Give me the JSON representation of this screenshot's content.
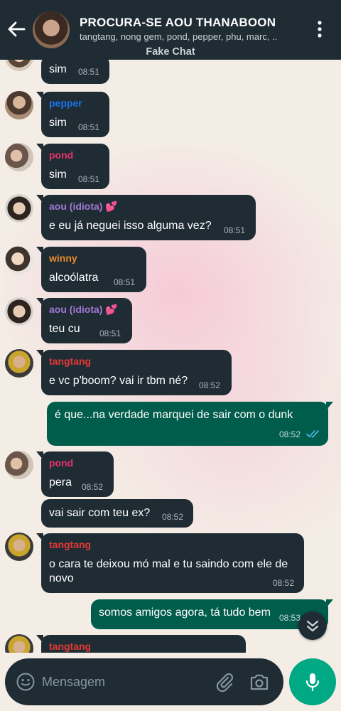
{
  "header": {
    "title": "PROCURA-SE AOU THANABOON",
    "subtitle": "tangtang, nong gem, pond, pepper, phu, marc, ..",
    "watermark": "Fake Chat"
  },
  "messages": [
    {
      "sender": "",
      "text": "sim",
      "time": "08:51"
    },
    {
      "sender": "pepper",
      "sender_color": "#1a73e8",
      "text": "sim",
      "time": "08:51"
    },
    {
      "sender": "pond",
      "sender_color": "#e5336d",
      "text": "sim",
      "time": "08:51"
    },
    {
      "sender": "aou (idiota) 💕",
      "sender_color": "#a27ad6",
      "text": "e eu já neguei isso alguma vez?",
      "time": "08:51"
    },
    {
      "sender": "winny",
      "sender_color": "#ea8a2e",
      "text": "alcoólatra",
      "time": "08:51"
    },
    {
      "sender": "aou (idiota) 💕",
      "sender_color": "#a27ad6",
      "text": "teu cu",
      "time": "08:51"
    },
    {
      "sender": "tangtang",
      "sender_color": "#e53935",
      "text": "e vc p'boom? vai ir tbm né?",
      "time": "08:52"
    },
    {
      "sender": "",
      "text": "é que...na verdade marquei de sair com o dunk",
      "time": "08:52",
      "outgoing": true
    },
    {
      "sender": "pond",
      "sender_color": "#e5336d",
      "text": "pera",
      "time": "08:52"
    },
    {
      "sender": "",
      "text": "vai sair com teu ex?",
      "time": "08:52"
    },
    {
      "sender": "tangtang",
      "sender_color": "#e53935",
      "text_line1": "o cara te deixou mó mal e tu saindo com ele de",
      "text_line2": "novo",
      "time": "08:52"
    },
    {
      "sender": "",
      "text": "somos amigos agora, tá tudo bem",
      "time": "08:53",
      "outgoing": true
    },
    {
      "sender": "tangtang",
      "sender_color": "#e53935",
      "text": "",
      "time": ""
    }
  ],
  "composer": {
    "placeholder": "Mensagem"
  },
  "colors": {
    "header_bg": "#1f2c34",
    "incoming_bubble": "#1f2c34",
    "outgoing_bubble": "#005c4b",
    "accent": "#00a884",
    "read_ticks": "#53bdeb"
  }
}
